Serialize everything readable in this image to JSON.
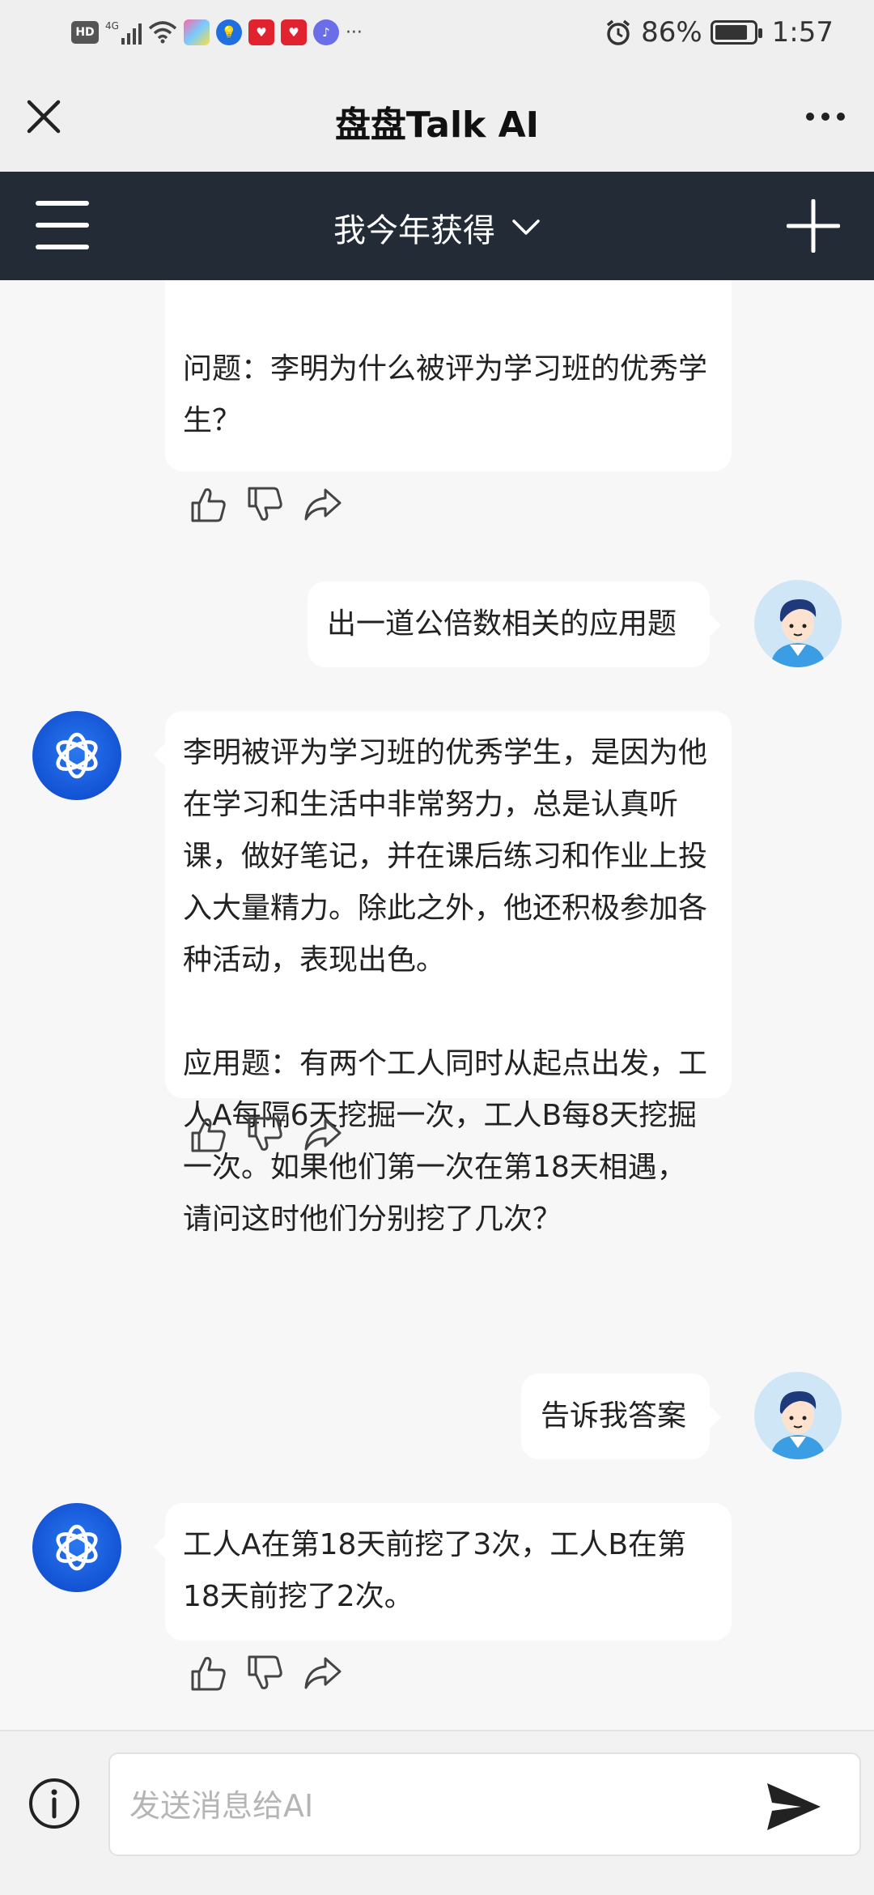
{
  "status_bar": {
    "network": "HD",
    "signal": "4G",
    "overflow": "···",
    "battery": "86%",
    "time": "1:57",
    "battery_level": 0.86
  },
  "titlebar": {
    "title": "盘盘Talk AI"
  },
  "appbar": {
    "title": "我今年获得",
    "dropdown_icon": "chevron-down-icon"
  },
  "messages": [
    {
      "role": "assistant",
      "text": "不断努力，一步步走出自己的道路。\n\n问题：李明为什么被评为学习班的优秀学生？"
    },
    {
      "role": "user",
      "text": "出一道公倍数相关的应用题"
    },
    {
      "role": "assistant",
      "text": "李明被评为学习班的优秀学生，是因为他在学习和生活中非常努力，总是认真听课，做好笔记，并在课后练习和作业上投入大量精力。除此之外，他还积极参加各种活动，表现出色。\n\n应用题：有两个工人同时从起点出发，工人A每隔6天挖掘一次，工人B每8天挖掘一次。如果他们第一次在第18天相遇，请问这时他们分别挖了几次？"
    },
    {
      "role": "user",
      "text": "告诉我答案"
    },
    {
      "role": "assistant",
      "text": "工人A在第18天前挖了3次，工人B在第18天前挖了2次。"
    }
  ],
  "input": {
    "placeholder": "发送消息给AI"
  },
  "colors": {
    "appbar": "#222b36",
    "ai_avatar": "#1353d4",
    "background": "#f7f7f7"
  }
}
